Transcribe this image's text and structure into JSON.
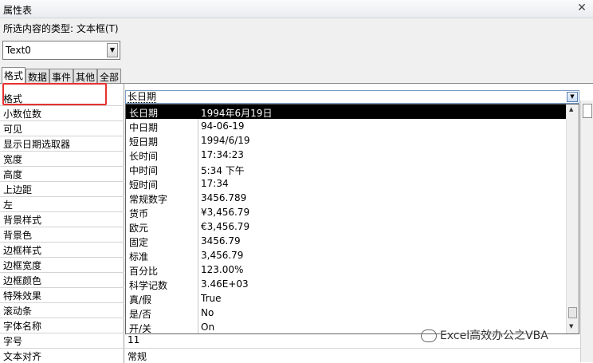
{
  "window": {
    "title": "属性表"
  },
  "selection_type_label": "所选内容的类型: 文本框(T)",
  "object_combo": {
    "value": "Text0"
  },
  "tabs": [
    {
      "label": "格式",
      "active": true
    },
    {
      "label": "数据",
      "active": false
    },
    {
      "label": "事件",
      "active": false
    },
    {
      "label": "其他",
      "active": false
    },
    {
      "label": "全部",
      "active": false
    }
  ],
  "properties": [
    {
      "label": "格式",
      "value": "长日期"
    },
    {
      "label": "小数位数",
      "value": ""
    },
    {
      "label": "可见",
      "value": ""
    },
    {
      "label": "显示日期选取器",
      "value": ""
    },
    {
      "label": "宽度",
      "value": ""
    },
    {
      "label": "高度",
      "value": ""
    },
    {
      "label": "上边距",
      "value": ""
    },
    {
      "label": "左",
      "value": ""
    },
    {
      "label": "背景样式",
      "value": ""
    },
    {
      "label": "背景色",
      "value": ""
    },
    {
      "label": "边框样式",
      "value": ""
    },
    {
      "label": "边框宽度",
      "value": ""
    },
    {
      "label": "边框颜色",
      "value": ""
    },
    {
      "label": "特殊效果",
      "value": ""
    },
    {
      "label": "滚动条",
      "value": ""
    },
    {
      "label": "字体名称",
      "value": ""
    },
    {
      "label": "字号",
      "value": "11"
    },
    {
      "label": "文本对齐",
      "value": "常规"
    }
  ],
  "format_dropdown": {
    "current": "长日期",
    "options": [
      {
        "name": "长日期",
        "sample": "1994年6月19日",
        "selected": true
      },
      {
        "name": "中日期",
        "sample": "94-06-19"
      },
      {
        "name": "短日期",
        "sample": "1994/6/19"
      },
      {
        "name": "长时间",
        "sample": "17:34:23"
      },
      {
        "name": "中时间",
        "sample": "5:34 下午"
      },
      {
        "name": "短时间",
        "sample": "17:34"
      },
      {
        "name": "常规数字",
        "sample": "3456.789"
      },
      {
        "name": "货币",
        "sample": "¥3,456.79"
      },
      {
        "name": "欧元",
        "sample": "€3,456.79"
      },
      {
        "name": "固定",
        "sample": "3456.79"
      },
      {
        "name": "标准",
        "sample": "3,456.79"
      },
      {
        "name": "百分比",
        "sample": "123.00%"
      },
      {
        "name": "科学记数",
        "sample": "3.46E+03"
      },
      {
        "name": "真/假",
        "sample": "True"
      },
      {
        "name": "是/否",
        "sample": "No"
      },
      {
        "name": "开/关",
        "sample": "On"
      }
    ]
  },
  "watermark": {
    "text": "Excel高效办公之VBA"
  },
  "colors": {
    "highlight_box": "#e83030",
    "selected_bg": "#000000"
  }
}
